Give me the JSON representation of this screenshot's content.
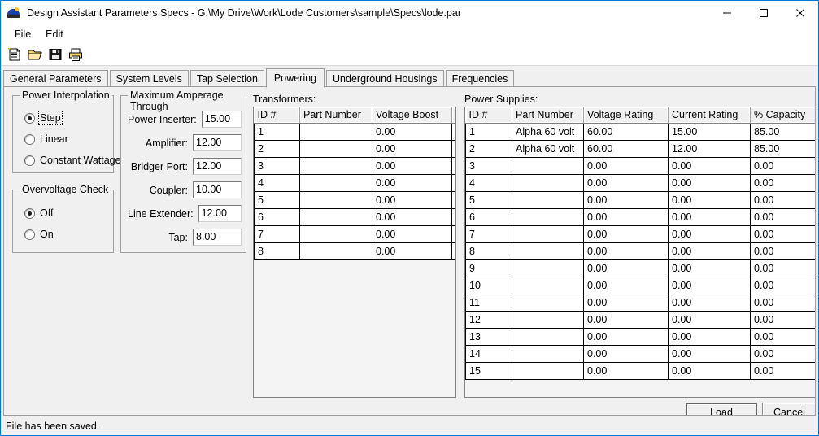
{
  "window": {
    "title": "Design Assistant Parameters Specs - G:\\My Drive\\Work\\Lode Customers\\sample\\Specs\\lode.par",
    "icon": "app-icon",
    "controls": {
      "minimize": "minimize-icon",
      "maximize": "maximize-icon",
      "close": "close-icon"
    },
    "border_color": "#0078d7"
  },
  "menubar": {
    "items": [
      {
        "label": "File"
      },
      {
        "label": "Edit"
      }
    ]
  },
  "toolbar": {
    "buttons": [
      {
        "icon": "new-document-icon",
        "tooltip": "New"
      },
      {
        "icon": "open-folder-icon",
        "tooltip": "Open"
      },
      {
        "icon": "save-floppy-icon",
        "tooltip": "Save"
      },
      {
        "icon": "print-icon",
        "tooltip": "Print"
      }
    ]
  },
  "tabs": {
    "active": "Powering",
    "items": [
      {
        "label": "General Parameters"
      },
      {
        "label": "System Levels"
      },
      {
        "label": "Tap Selection"
      },
      {
        "label": "Powering"
      },
      {
        "label": "Underground Housings"
      },
      {
        "label": "Frequencies"
      }
    ]
  },
  "power_interpolation": {
    "title": "Power Interpolation",
    "selected": "Step",
    "options": [
      {
        "label": "Step",
        "checked": true,
        "focused": true
      },
      {
        "label": "Linear",
        "checked": false,
        "focused": false
      },
      {
        "label": "Constant Wattage",
        "checked": false,
        "focused": false
      }
    ]
  },
  "overvoltage_check": {
    "title": "Overvoltage Check",
    "selected": "Off",
    "options": [
      {
        "label": "Off",
        "checked": true,
        "focused": false
      },
      {
        "label": "On",
        "checked": false,
        "focused": false
      }
    ]
  },
  "max_amperage": {
    "title": "Maximum Amperage Through",
    "fields": [
      {
        "label": "Power Inserter:",
        "value": "15.00"
      },
      {
        "label": "Amplifier:",
        "value": "12.00"
      },
      {
        "label": "Bridger Port:",
        "value": "12.00"
      },
      {
        "label": "Coupler:",
        "value": "10.00"
      },
      {
        "label": "Line Extender:",
        "value": "12.00"
      },
      {
        "label": "Tap:",
        "value": "8.00"
      }
    ]
  },
  "transformers": {
    "caption": "Transformers:",
    "columns": [
      "ID #",
      "Part Number",
      "Voltage Boost",
      ""
    ],
    "rows": [
      {
        "id": "1",
        "part_number": "",
        "voltage_boost": "0.00",
        "extra": ""
      },
      {
        "id": "2",
        "part_number": "",
        "voltage_boost": "0.00",
        "extra": ""
      },
      {
        "id": "3",
        "part_number": "",
        "voltage_boost": "0.00",
        "extra": ""
      },
      {
        "id": "4",
        "part_number": "",
        "voltage_boost": "0.00",
        "extra": ""
      },
      {
        "id": "5",
        "part_number": "",
        "voltage_boost": "0.00",
        "extra": ""
      },
      {
        "id": "6",
        "part_number": "",
        "voltage_boost": "0.00",
        "extra": ""
      },
      {
        "id": "7",
        "part_number": "",
        "voltage_boost": "0.00",
        "extra": ""
      },
      {
        "id": "8",
        "part_number": "",
        "voltage_boost": "0.00",
        "extra": ""
      }
    ]
  },
  "power_supplies": {
    "caption": "Power Supplies:",
    "columns": [
      "ID #",
      "Part Number",
      "Voltage Rating",
      "Current Rating",
      "% Capacity"
    ],
    "rows": [
      {
        "id": "1",
        "part_number": "Alpha 60 volt",
        "voltage_rating": "60.00",
        "current_rating": "15.00",
        "percent_capacity": "85.00"
      },
      {
        "id": "2",
        "part_number": "Alpha 60 volt",
        "voltage_rating": "60.00",
        "current_rating": "12.00",
        "percent_capacity": "85.00"
      },
      {
        "id": "3",
        "part_number": "",
        "voltage_rating": "0.00",
        "current_rating": "0.00",
        "percent_capacity": "0.00"
      },
      {
        "id": "4",
        "part_number": "",
        "voltage_rating": "0.00",
        "current_rating": "0.00",
        "percent_capacity": "0.00"
      },
      {
        "id": "5",
        "part_number": "",
        "voltage_rating": "0.00",
        "current_rating": "0.00",
        "percent_capacity": "0.00"
      },
      {
        "id": "6",
        "part_number": "",
        "voltage_rating": "0.00",
        "current_rating": "0.00",
        "percent_capacity": "0.00"
      },
      {
        "id": "7",
        "part_number": "",
        "voltage_rating": "0.00",
        "current_rating": "0.00",
        "percent_capacity": "0.00"
      },
      {
        "id": "8",
        "part_number": "",
        "voltage_rating": "0.00",
        "current_rating": "0.00",
        "percent_capacity": "0.00"
      },
      {
        "id": "9",
        "part_number": "",
        "voltage_rating": "0.00",
        "current_rating": "0.00",
        "percent_capacity": "0.00"
      },
      {
        "id": "10",
        "part_number": "",
        "voltage_rating": "0.00",
        "current_rating": "0.00",
        "percent_capacity": "0.00"
      },
      {
        "id": "11",
        "part_number": "",
        "voltage_rating": "0.00",
        "current_rating": "0.00",
        "percent_capacity": "0.00"
      },
      {
        "id": "12",
        "part_number": "",
        "voltage_rating": "0.00",
        "current_rating": "0.00",
        "percent_capacity": "0.00"
      },
      {
        "id": "13",
        "part_number": "",
        "voltage_rating": "0.00",
        "current_rating": "0.00",
        "percent_capacity": "0.00"
      },
      {
        "id": "14",
        "part_number": "",
        "voltage_rating": "0.00",
        "current_rating": "0.00",
        "percent_capacity": "0.00"
      },
      {
        "id": "15",
        "part_number": "",
        "voltage_rating": "0.00",
        "current_rating": "0.00",
        "percent_capacity": "0.00"
      }
    ]
  },
  "actions": {
    "load_label": "Load",
    "load_accesskey": "L",
    "load_rest": "oad",
    "cancel_label": "Cancel"
  },
  "statusbar": {
    "message": "File has been saved."
  }
}
